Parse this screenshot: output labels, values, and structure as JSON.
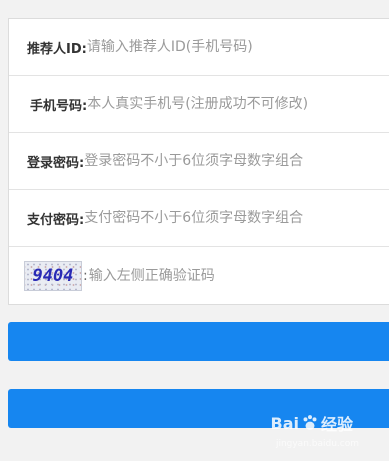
{
  "form": {
    "referrer": {
      "label": "推荐人ID:",
      "placeholder": "请输入推荐人ID(手机号码)"
    },
    "phone": {
      "label": "手机号码:",
      "placeholder": "本人真实手机号(注册成功不可修改)"
    },
    "login_password": {
      "label": "登录密码:",
      "placeholder": "登录密码不小于6位须字母数字组合"
    },
    "pay_password": {
      "label": "支付密码:",
      "placeholder": "支付密码不小于6位须字母数字组合"
    },
    "captcha": {
      "image_text": "9404",
      "separator": ":",
      "placeholder": "输入左侧正确验证码"
    }
  },
  "buttons": {
    "primary_label": "",
    "secondary_label": ""
  },
  "watermark": {
    "brand": "Bai",
    "brand_suffix": "经验",
    "url": "jingyan.baidu.com"
  },
  "colors": {
    "button": "#1686f0",
    "background": "#f2f2f2",
    "captcha_text": "#2a2ab5"
  }
}
